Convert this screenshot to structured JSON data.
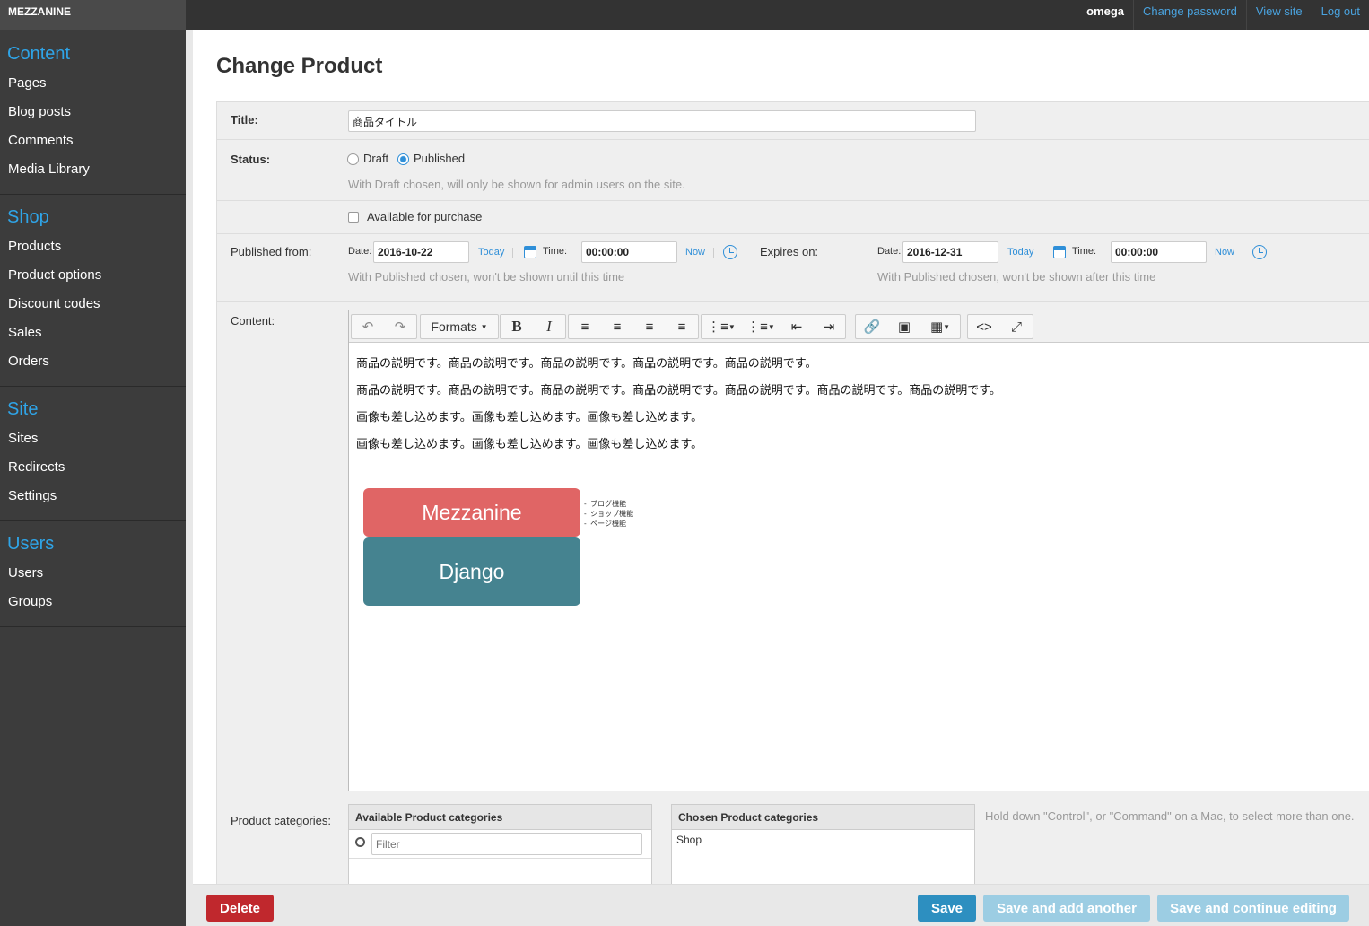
{
  "app": {
    "brand": "MEZZANINE"
  },
  "topbar": {
    "user": "omega",
    "change_password": "Change password",
    "view_site": "View site",
    "log_out": "Log out"
  },
  "sidebar": {
    "content": {
      "head": "Content",
      "items": [
        "Pages",
        "Blog posts",
        "Comments",
        "Media Library"
      ]
    },
    "shop": {
      "head": "Shop",
      "items": [
        "Products",
        "Product options",
        "Discount codes",
        "Sales",
        "Orders"
      ]
    },
    "site": {
      "head": "Site",
      "items": [
        "Sites",
        "Redirects",
        "Settings"
      ]
    },
    "users": {
      "head": "Users",
      "items": [
        "Users",
        "Groups"
      ]
    }
  },
  "page": {
    "title": "Change Product"
  },
  "form": {
    "title_label": "Title:",
    "title_value": "商品タイトル",
    "status_label": "Status:",
    "draft": "Draft",
    "published": "Published",
    "status_selected": "Published",
    "status_help": "With Draft chosen, will only be shown for admin users on the site.",
    "available_label": "Available for purchase",
    "available_checked": false,
    "published_from_label": "Published from:",
    "expires_on_label": "Expires on:",
    "date_label": "Date:",
    "time_label": "Time:",
    "today": "Today",
    "now": "Now",
    "pub_date": "2016-10-22",
    "pub_time": "00:00:00",
    "exp_date": "2016-12-31",
    "exp_time": "00:00:00",
    "pub_help": "With Published chosen, won't be shown until this time",
    "exp_help": "With Published chosen, won't be shown after this time",
    "content_label": "Content:",
    "categories_label": "Product categories:",
    "available_cats": "Available Product categories",
    "chosen_cats": "Chosen Product categories",
    "filter_placeholder": "Filter",
    "chosen_items": [
      "Shop"
    ],
    "cats_help": "Hold down \"Control\", or \"Command\" on a Mac, to select more than one."
  },
  "editor": {
    "formats": "Formats",
    "paragraphs": [
      "商品の説明です。商品の説明です。商品の説明です。商品の説明です。商品の説明です。",
      "商品の説明です。商品の説明です。商品の説明です。商品の説明です。商品の説明です。商品の説明です。商品の説明です。",
      "画像も差し込めます。画像も差し込めます。画像も差し込めます。",
      "画像も差し込めます。画像も差し込めます。画像も差し込めます。"
    ],
    "diagram": {
      "top": "Mezzanine",
      "bottom": "Django",
      "top_color": "#e06565",
      "bottom_color": "#458390",
      "bullets": [
        "ブログ機能",
        "ショップ機能",
        "ページ機能"
      ]
    }
  },
  "footer": {
    "delete": "Delete",
    "save": "Save",
    "save_add": "Save and add another",
    "save_continue": "Save and continue editing"
  },
  "colors": {
    "accent": "#2fa4e7",
    "delete": "#c0282d",
    "save": "#2d8fc0",
    "disabled": "#9ccde3"
  }
}
